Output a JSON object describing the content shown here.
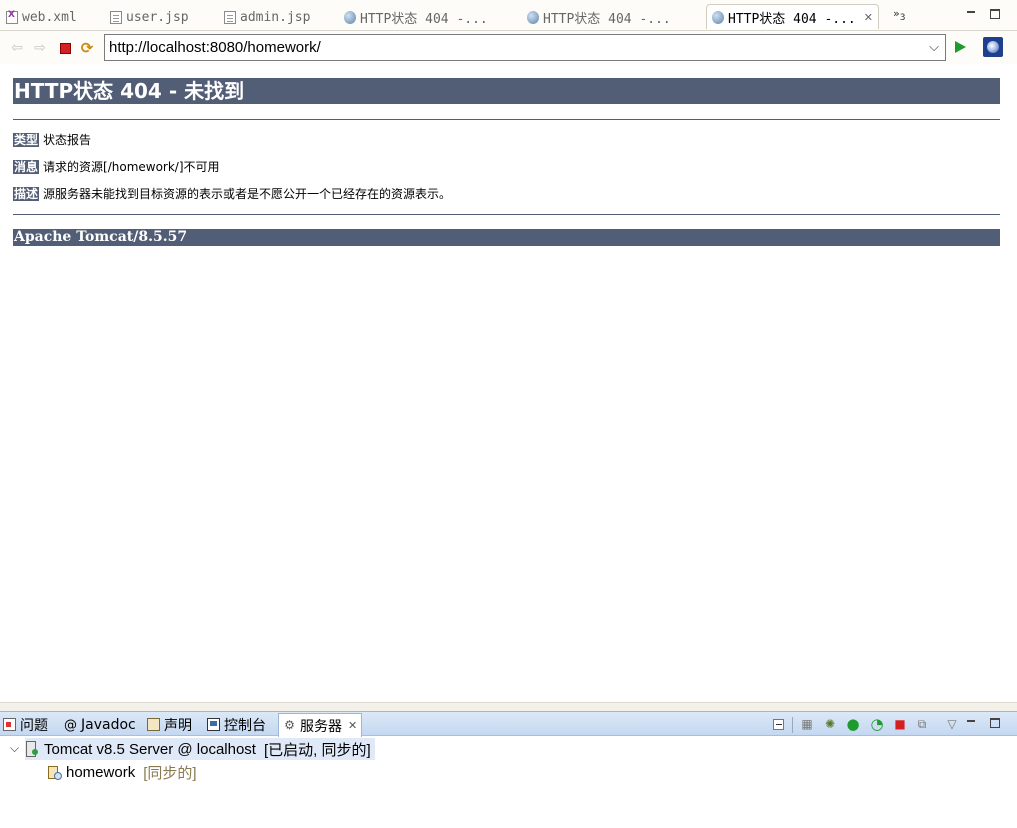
{
  "editor_tabs": [
    {
      "label": "web.xml",
      "icon": "xml-file-icon",
      "active": false
    },
    {
      "label": "user.jsp",
      "icon": "jsp-file-icon",
      "active": false
    },
    {
      "label": "admin.jsp",
      "icon": "jsp-file-icon",
      "active": false
    },
    {
      "label": "HTTP状态 404 -...",
      "icon": "globe-icon",
      "active": false
    },
    {
      "label": "HTTP状态 404 -...",
      "icon": "globe-icon",
      "active": false
    },
    {
      "label": "HTTP状态 404 -...",
      "icon": "globe-icon",
      "active": true
    }
  ],
  "overflow": {
    "symbol": "»",
    "count": "3"
  },
  "browser": {
    "url": "http://localhost:8080/homework/"
  },
  "error_page": {
    "title": "HTTP状态 404 - 未找到",
    "type_label": "类型",
    "type_value": "状态报告",
    "message_label": "消息",
    "message_value": "请求的资源[/homework/]不可用",
    "description_label": "描述",
    "description_value": "源服务器未能找到目标资源的表示或者是不愿公开一个已经存在的资源表示。",
    "footer": "Apache Tomcat/8.5.57",
    "header_color": "#525d76"
  },
  "views": {
    "tabs": [
      {
        "label": "问题",
        "icon": "problems-icon"
      },
      {
        "label": "Javadoc",
        "icon": "at-icon"
      },
      {
        "label": "声明",
        "icon": "declaration-icon"
      },
      {
        "label": "控制台",
        "icon": "console-icon"
      },
      {
        "label": "服务器",
        "icon": "servers-icon",
        "active": true
      }
    ]
  },
  "servers": {
    "server": {
      "name": "Tomcat v8.5 Server @ localhost",
      "state": "[已启动, 同步的]"
    },
    "modules": [
      {
        "name": "homework",
        "state": "[同步的]"
      }
    ]
  }
}
